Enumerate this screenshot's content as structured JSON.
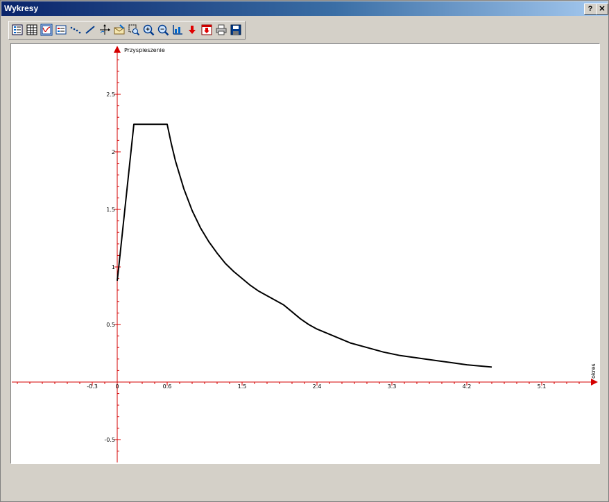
{
  "window": {
    "title": "Wykresy",
    "help_label": "?",
    "close_label": "✕"
  },
  "toolbar": {
    "icons": [
      "list-icon",
      "table-icon",
      "chart-view-icon",
      "legend-icon",
      "points-line-icon",
      "line-icon",
      "axes-icon",
      "annotate-icon",
      "zoom-area-icon",
      "zoom-in-icon",
      "zoom-out-icon",
      "scale-icon",
      "down-arrow-icon",
      "export-icon",
      "print-icon",
      "save-icon"
    ]
  },
  "colors": {
    "axis": "#d40000",
    "curve": "#000000",
    "titlebar_start": "#0a246a",
    "titlebar_end": "#a6caf0"
  },
  "chart_data": {
    "type": "line",
    "ylabel": "Przyspieszenie",
    "xlabel": "okres",
    "xlim": [
      -1.2,
      5.7
    ],
    "ylim": [
      -0.7,
      2.9
    ],
    "x_ticks": [
      -0.3,
      0,
      0.6,
      1.5,
      2.4,
      3.3,
      4.2,
      5.1
    ],
    "x_tick_labels": [
      "-0.3",
      "0",
      "0.6",
      "1.5",
      "2.4",
      "3.3",
      "4.2",
      "5.1"
    ],
    "y_ticks": [
      -0.5,
      0.5,
      1,
      1.5,
      2,
      2.5
    ],
    "y_tick_labels": [
      "-0.5",
      "0.5",
      "1",
      "1.5",
      "2",
      "2.5"
    ],
    "grid": false,
    "series": [
      {
        "x": [
          0.0,
          0.02,
          0.2,
          0.6,
          0.65,
          0.7,
          0.8,
          0.9,
          1.0,
          1.1,
          1.2,
          1.3,
          1.4,
          1.5,
          1.6,
          1.7,
          1.8,
          1.9,
          2.0,
          2.1,
          2.2,
          2.3,
          2.4,
          2.6,
          2.8,
          3.0,
          3.2,
          3.4,
          3.6,
          3.8,
          4.0,
          4.2,
          4.5
        ],
        "y": [
          0.88,
          1.01,
          2.24,
          2.24,
          2.07,
          1.92,
          1.68,
          1.49,
          1.34,
          1.22,
          1.12,
          1.03,
          0.96,
          0.9,
          0.84,
          0.79,
          0.75,
          0.71,
          0.67,
          0.61,
          0.55,
          0.5,
          0.46,
          0.4,
          0.34,
          0.3,
          0.26,
          0.23,
          0.21,
          0.19,
          0.17,
          0.15,
          0.13
        ]
      }
    ]
  }
}
